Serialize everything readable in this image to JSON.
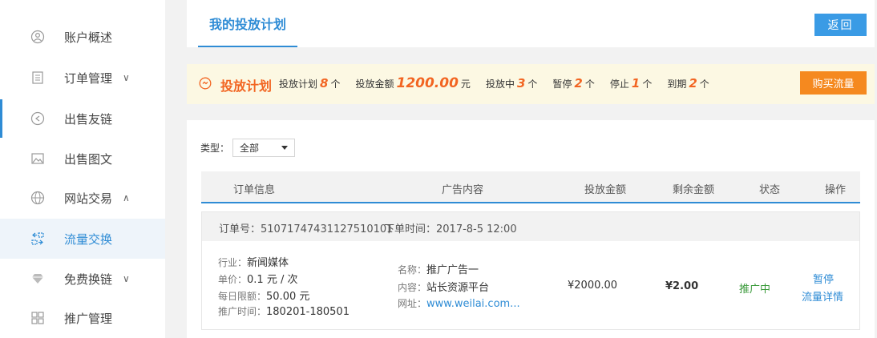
{
  "sidebar": {
    "items": [
      {
        "label": "账户概述",
        "icon": "user-circle-icon"
      },
      {
        "label": "订单管理",
        "icon": "document-icon",
        "chevron": "∨"
      },
      {
        "label": "出售友链",
        "icon": "share-icon"
      },
      {
        "label": "出售图文",
        "icon": "image-icon"
      },
      {
        "label": "网站交易",
        "icon": "globe-icon",
        "chevron": "∧"
      },
      {
        "label": "流量交换",
        "icon": "exchange-icon"
      },
      {
        "label": "免费换链",
        "icon": "gem-icon",
        "chevron": "∨"
      },
      {
        "label": "推广管理",
        "icon": "grid-icon"
      }
    ]
  },
  "header": {
    "tab": "我的投放计划",
    "back_label": "返回"
  },
  "summary": {
    "title": "投放计划",
    "plans_label": "投放计划",
    "plans_value": "8",
    "plans_unit": "个",
    "amount_label": "投放金额",
    "amount_value": "1200.00",
    "amount_unit": "元",
    "active_label": "投放中",
    "active_value": "3",
    "active_unit": "个",
    "paused_label": "暂停",
    "paused_value": "2",
    "paused_unit": "个",
    "stopped_label": "停止",
    "stopped_value": "1",
    "stopped_unit": "个",
    "expired_label": "到期",
    "expired_value": "2",
    "expired_unit": "个",
    "buy_label": "购买流量"
  },
  "filter": {
    "label": "类型：",
    "selected": "全部"
  },
  "table": {
    "columns": [
      "订单信息",
      "广告内容",
      "投放金额",
      "剩余金额",
      "状态",
      "操作"
    ]
  },
  "order": {
    "number": "订单号：51071747431127510101",
    "time": "下单时间：2017-8-5  12:00",
    "industry_label": "行业：",
    "industry": "新闻媒体",
    "price_label": "单价：",
    "price": "0.1 元 / 次",
    "limit_label": "每日限额：",
    "limit": "50.00 元",
    "period_label": "推广时间：",
    "period": "180201-180501",
    "name_label": "名称：",
    "name": "推广广告一",
    "content_label": "内容：",
    "content": "站长资源平台",
    "url_label": "网址：",
    "url": "www.weilai.com...",
    "amount": "¥2000.00",
    "remaining": "¥2.00",
    "status": "推广中",
    "op_pause": "暂停",
    "op_detail": "流量详情"
  },
  "colors": {
    "accent": "#2f8cd5",
    "highlight": "#f26522",
    "buy_button": "#f5891f",
    "status_green": "#3a9a3a"
  }
}
